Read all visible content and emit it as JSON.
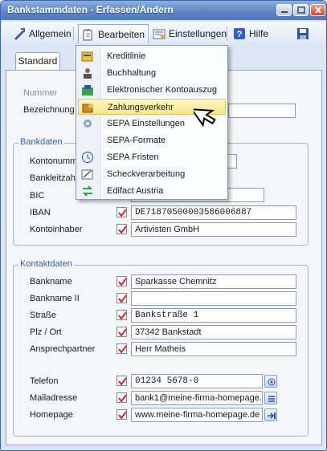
{
  "window": {
    "title": "Bankstammdaten - Erfassen/Ändern"
  },
  "toolbar": {
    "allgemein": "Allgemein",
    "bearbeiten": "Bearbeiten",
    "einstellungen": "Einstellungen",
    "hilfe": "Hilfe"
  },
  "tabs": {
    "standard": "Standard"
  },
  "top": {
    "nummer_label": "Nummer",
    "bezeichnung_label": "Bezeichnung"
  },
  "bankdaten": {
    "title": "Bankdaten",
    "kontonummer_label": "Kontonumm",
    "bankleitzahl_label": "Bankleitzahl",
    "bic_label": "BIC",
    "iban_label": "IBAN",
    "iban_value": "DE71870500003586006887",
    "kontoinhaber_label": "Kontoinhaber",
    "kontoinhaber_value": "Artivisten GmbH"
  },
  "kontaktdaten": {
    "title": "Kontaktdaten",
    "bankname_label": "Bankname",
    "bankname_value": "Sparkasse Chemnitz",
    "bankname2_label": "Bankname II",
    "bankname2_value": "",
    "strasse_label": "Straße",
    "strasse_value": "Bankstraße 1",
    "plzort_label": "Plz / Ort",
    "plzort_value": "37342 Bankstadt",
    "ansprechpartner_label": "Ansprechpartner",
    "ansprechpartner_value": "Herr Matheis",
    "telefon_label": "Telefon",
    "telefon_value": "01234 5678-0",
    "mail_label": "Mailadresse",
    "mail_value": "bank1@meine-firma-homepage.d",
    "homepage_label": "Homepage",
    "homepage_value": "www.meine-firma-homepage.de"
  },
  "menu": {
    "items": [
      {
        "label": "Kreditlinie",
        "icon": "credit-line-icon"
      },
      {
        "label": "Buchhaltung",
        "icon": "accounting-icon"
      },
      {
        "label": "Elektronischer Kontoauszug",
        "icon": "bank-statement-icon"
      },
      {
        "label": "Zahlungsverkehr",
        "icon": "payment-icon"
      },
      {
        "label": "SEPA Einstellungen",
        "icon": "sepa-settings-icon"
      },
      {
        "label": "SEPA-Formate",
        "icon": "sepa-formats-icon"
      },
      {
        "label": "SEPA Fristen",
        "icon": "clock-icon"
      },
      {
        "label": "Scheckverarbeitung",
        "icon": "cheque-icon"
      },
      {
        "label": "Edifact Austria",
        "icon": "edifact-icon"
      }
    ]
  },
  "colors": {
    "accent": "#3b5fa8",
    "highlight": "#fde58d",
    "checkmark": "#d8262c"
  }
}
